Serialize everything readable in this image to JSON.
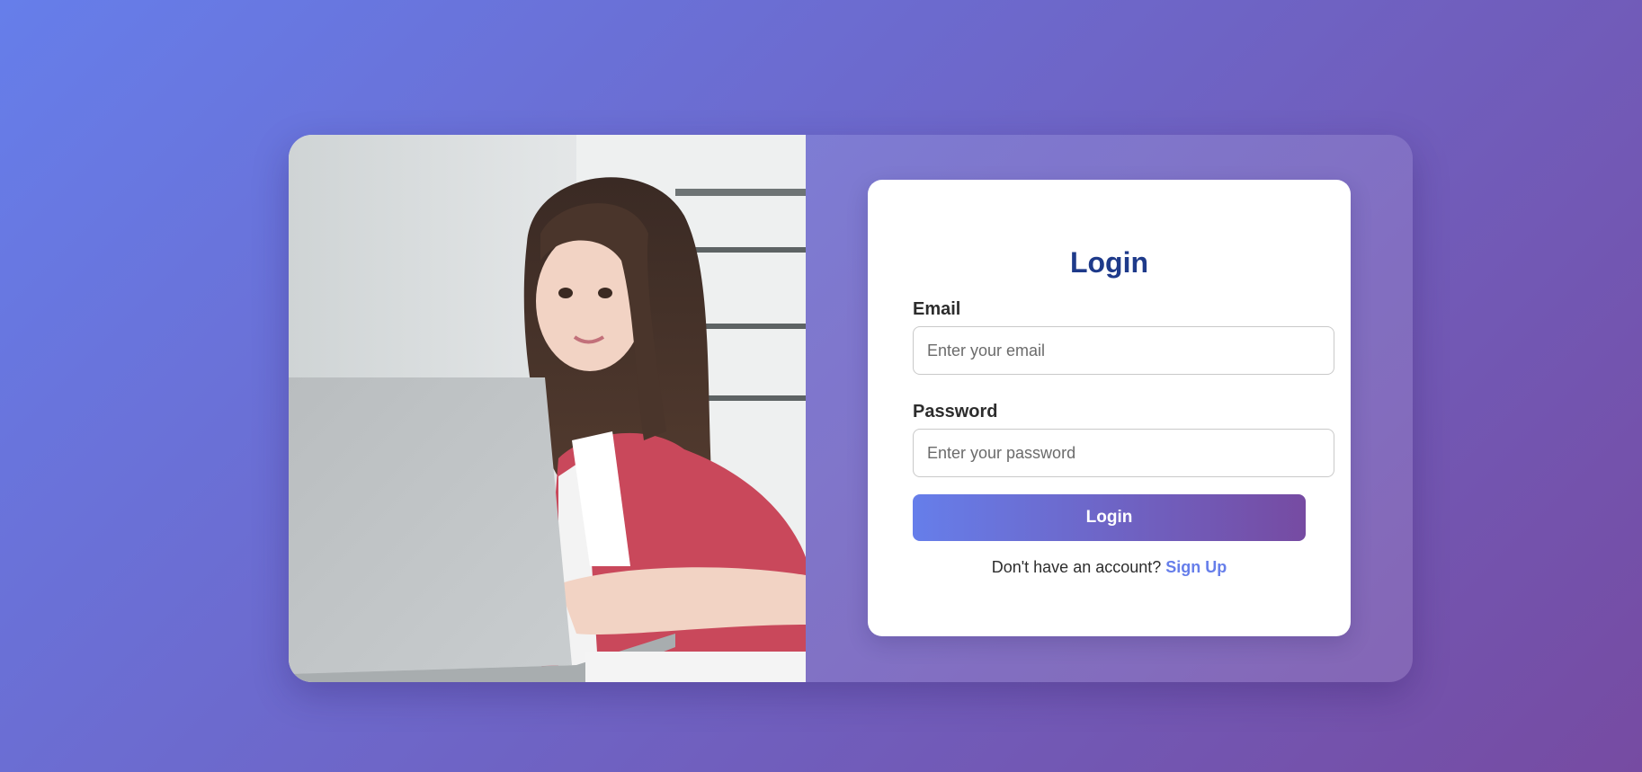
{
  "login": {
    "title": "Login",
    "email_label": "Email",
    "email_placeholder": "Enter your email",
    "password_label": "Password",
    "password_placeholder": "Enter your password",
    "submit_label": "Login",
    "signup_prompt": "Don't have an account?",
    "signup_link": "Sign Up"
  },
  "colors": {
    "background_gradient_start": "#667eea",
    "background_gradient_end": "#764ba2",
    "title": "#1e3a8a",
    "link": "#667eea"
  }
}
